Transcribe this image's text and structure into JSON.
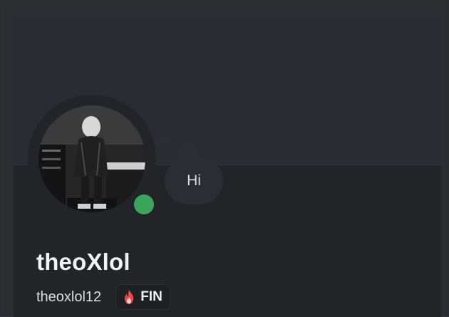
{
  "profile": {
    "display_name": "theoXlol",
    "username": "theoxlol12",
    "status": "online",
    "status_color": "#3ba55d",
    "custom_status": "Hi",
    "clan_tag": {
      "label": "FIN",
      "icon": "flame-icon"
    },
    "avatar": "profile-avatar-photo"
  },
  "colors": {
    "card_bg": "#232428",
    "banner_bg": "#2b2c31",
    "text_primary": "#f2f3f5",
    "text_secondary": "#dbdee1"
  }
}
